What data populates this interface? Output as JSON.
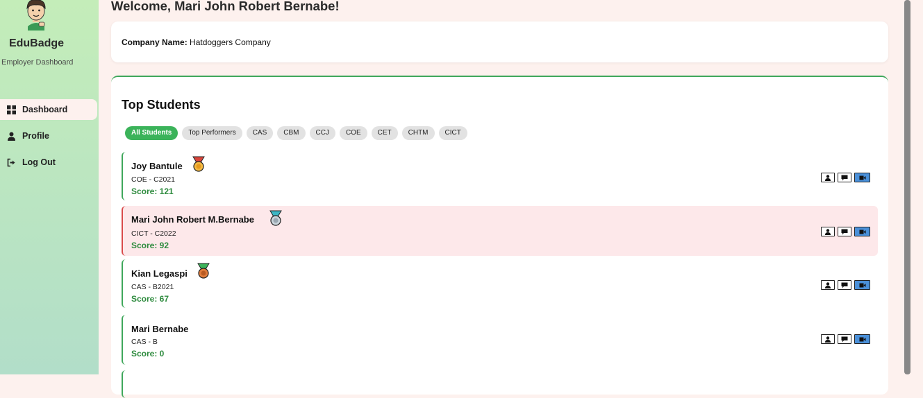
{
  "sidebar": {
    "brand": "EduBadge",
    "subtitle": "Employer Dashboard",
    "items": [
      {
        "label": "Dashboard",
        "icon": "grid-icon",
        "active": true
      },
      {
        "label": "Profile",
        "icon": "user-icon"
      },
      {
        "label": "Log Out",
        "icon": "logout-icon"
      }
    ]
  },
  "main": {
    "welcome": "Welcome, Mari John Robert Bernabe!",
    "company": {
      "label": "Company Name:",
      "value": "Hatdoggers Company"
    },
    "section_title": "Top Students",
    "filters": [
      "All Students",
      "Top Performers",
      "CAS",
      "CBM",
      "CCJ",
      "COE",
      "CET",
      "CHTM",
      "CICT"
    ],
    "active_filter": "All Students",
    "students": [
      {
        "name": "Joy Bantule",
        "sub": "COE - C2021",
        "score": "Score: 121",
        "medal": "gold-medal-icon"
      },
      {
        "name": "Mari John Robert M.Bernabe",
        "sub": "CICT - C2022",
        "score": "Score: 92",
        "medal": "silver-medal-icon"
      },
      {
        "name": "Kian Legaspi",
        "sub": "CAS - B2021",
        "score": "Score: 67",
        "medal": "bronze-medal-icon"
      },
      {
        "name": "Mari Bernabe",
        "sub": "CAS - B",
        "score": "Score: 0",
        "medal": ""
      }
    ]
  },
  "colors": {
    "accent": "#3bb35a",
    "score": "#2e8b3e",
    "highlight_bg": "#fde8ea",
    "highlight_border": "#d94a4a",
    "video_button": "#4a90d9",
    "page_bg": "#fdf1ee"
  }
}
